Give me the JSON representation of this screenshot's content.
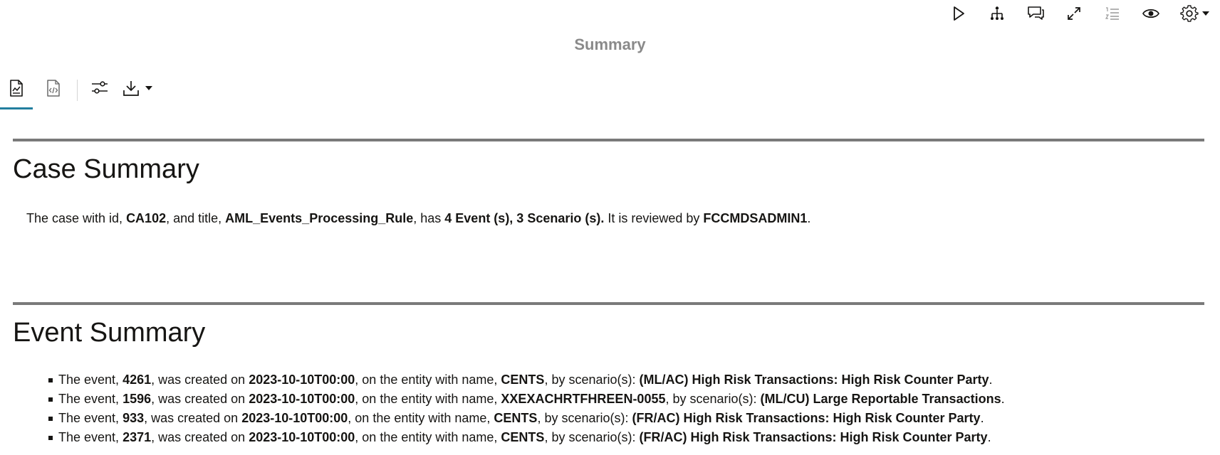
{
  "toolbar": {
    "icons": [
      "play-icon",
      "hierarchy-icon",
      "comments-icon",
      "expand-icon",
      "numbered-list-icon",
      "eye-icon",
      "gear-icon"
    ]
  },
  "page": {
    "title": "Summary"
  },
  "tabs": [
    "report-icon",
    "code-icon"
  ],
  "case_summary": {
    "heading": "Case Summary",
    "t1": "The case with id, ",
    "id": "CA102",
    "t2": ", and title, ",
    "title": "AML_Events_Processing_Rule",
    "t3": ", has ",
    "counts": "4 Event (s), 3 Scenario (s).",
    "t4": " It is reviewed by ",
    "reviewer": "FCCMDSADMIN1",
    "t5": "."
  },
  "event_summary": {
    "heading": "Event Summary",
    "p1": "The event, ",
    "p2": ", was created on ",
    "p3": ", on the entity with name, ",
    "p4": ", by scenario(s): ",
    "p5": ".",
    "events": [
      {
        "id": "4261",
        "date": "2023-10-10T00:00",
        "entity": "CENTS",
        "scenario": "(ML/AC) High Risk Transactions: High Risk Counter Party"
      },
      {
        "id": "1596",
        "date": "2023-10-10T00:00",
        "entity": "XXEXACHRTFHREEN-0055",
        "scenario": "(ML/CU) Large Reportable Transactions"
      },
      {
        "id": "933",
        "date": "2023-10-10T00:00",
        "entity": "CENTS",
        "scenario": "(FR/AC) High Risk Transactions: High Risk Counter Party"
      },
      {
        "id": "2371",
        "date": "2023-10-10T00:00",
        "entity": "CENTS",
        "scenario": "(FR/AC) High Risk Transactions: High Risk Counter Party"
      }
    ]
  }
}
